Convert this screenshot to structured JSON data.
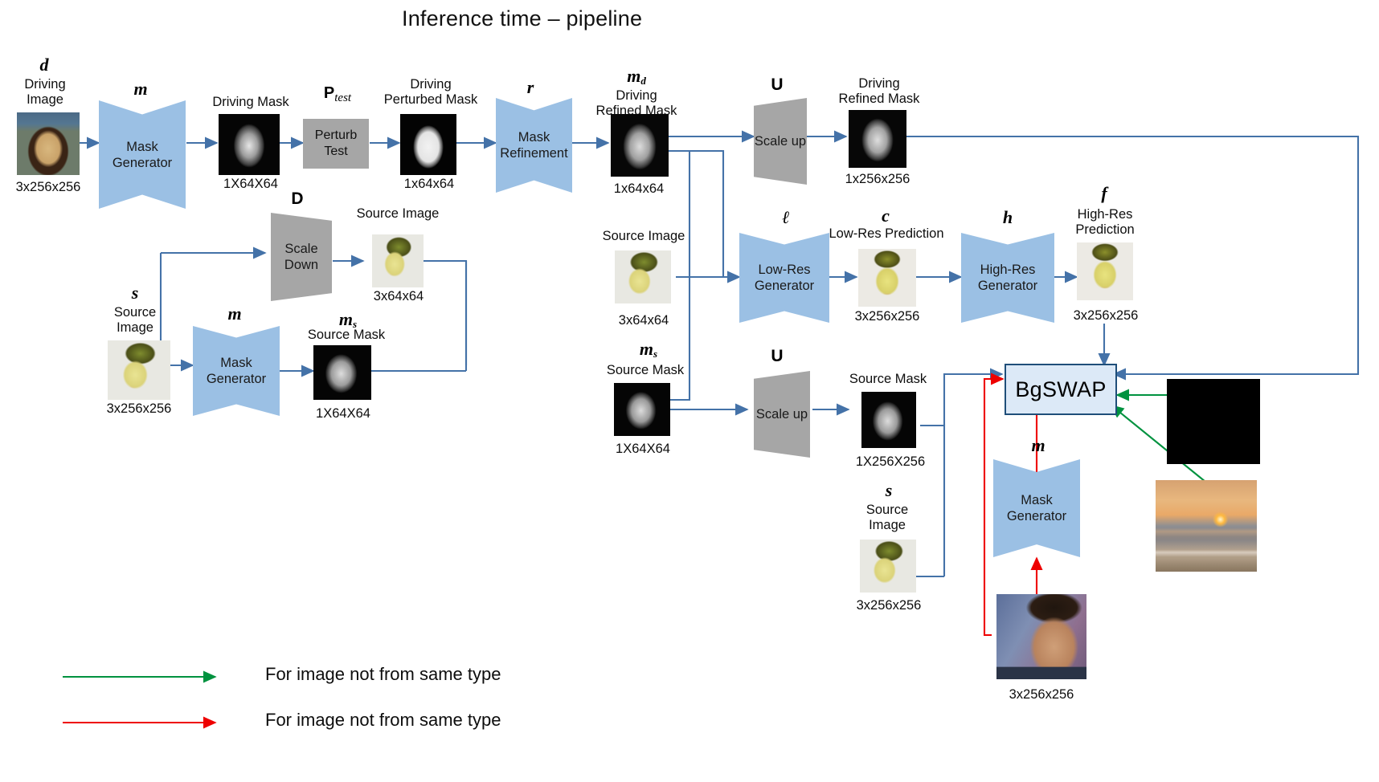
{
  "title": "Inference time – pipeline",
  "modules": {
    "mask_generator": "Mask\nGenerator",
    "mask_refinement": "Mask\nRefinement",
    "perturb_test": "Perturb\nTest",
    "scale_down": "Scale\nDown",
    "scale_up": "Scale\nup",
    "low_res_generator": "Low-Res\nGenerator",
    "high_res_generator": "High-Res\nGenerator",
    "bgswap": "BgSWAP"
  },
  "symbols": {
    "d": "d",
    "m": "m",
    "r": "r",
    "md": "m",
    "md_sub": "d",
    "ms": "m",
    "ms_sub": "s",
    "s": "s",
    "l": "ℓ",
    "c": "c",
    "h": "h",
    "f": "f",
    "U": "U",
    "D": "D",
    "P": "P",
    "P_sub": "test"
  },
  "nodes": {
    "driving_image": {
      "label": "Driving\nImage",
      "dims": "3x256x256"
    },
    "driving_mask": {
      "label": "Driving Mask",
      "dims": "1X64X64"
    },
    "driving_perturbed_mask": {
      "label": "Driving\nPerturbed Mask",
      "dims": "1x64x64"
    },
    "driving_refined_mask_low": {
      "label": "Driving\nRefined Mask",
      "dims": "1x64x64"
    },
    "driving_refined_mask_high": {
      "label": "Driving\nRefined Mask",
      "dims": "1x256x256"
    },
    "source_image_small": {
      "label": "Source Image",
      "dims": "3x64x64"
    },
    "source_image_left": {
      "label": "Source\nImage",
      "dims": "3x256x256"
    },
    "source_mask_left": {
      "label": "Source Mask",
      "dims": "1X64X64"
    },
    "source_image_mid": {
      "label": "Source Image",
      "dims": "3x64x64"
    },
    "source_mask_mid": {
      "label": "Source Mask",
      "dims": "1X64X64"
    },
    "source_mask_high": {
      "label": "Source Mask",
      "dims": "1X256X256"
    },
    "source_image_bottom": {
      "label": "Source\nImage",
      "dims": "3x256x256"
    },
    "low_res_prediction": {
      "label": "Low-Res Prediction",
      "dims": "3x256x256"
    },
    "high_res_prediction": {
      "label": "High-Res\nPrediction",
      "dims": "3x256x256"
    },
    "bg_face_image": {
      "dims": "3x256x256"
    }
  },
  "legend": {
    "green": "For image not from same type",
    "red": "For image not from same type"
  },
  "colors": {
    "module_blue": "#9bc0e4",
    "module_grey": "#a6a6a6",
    "bgswap_fill": "#dce9f7",
    "bgswap_border": "#1f4e79",
    "arrow_blue": "#4472a8",
    "arrow_green": "#00923f",
    "arrow_red": "#ee0000"
  }
}
